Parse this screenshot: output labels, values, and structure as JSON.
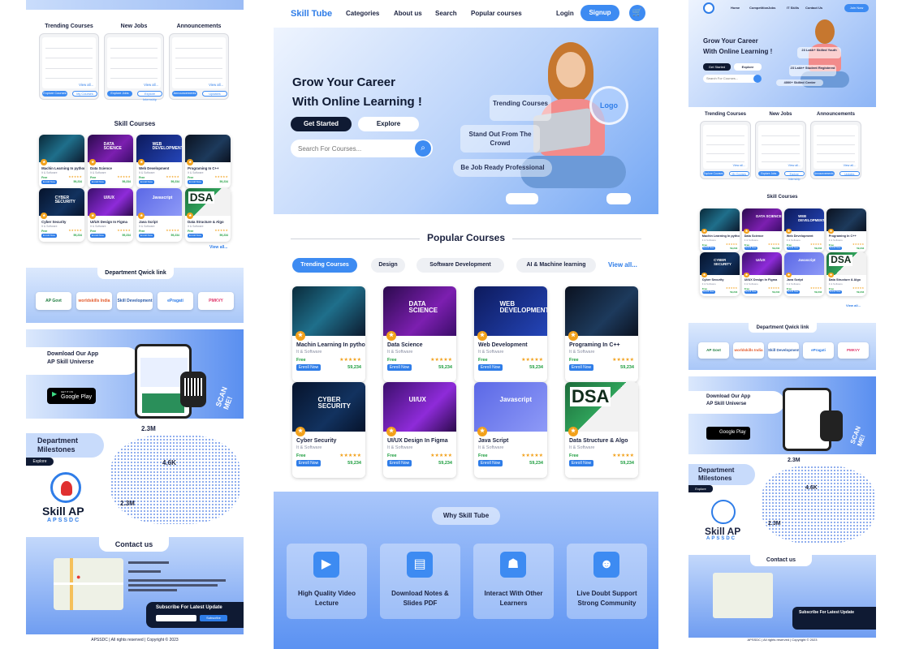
{
  "nav": {
    "brand": "Skill Tube",
    "links": [
      "Categories",
      "About us",
      "Search",
      "Popular courses"
    ],
    "login": "Login",
    "signup": "Signup"
  },
  "hero": {
    "title_line1": "Grow Your Career",
    "title_line2": "With Online Learning !",
    "get_started": "Get Started",
    "explore": "Explore",
    "search_placeholder": "Search For Courses...",
    "chip1": "Trending Courses",
    "chip2": "Stand Out From The Crowd",
    "chip3": "Be Job Ready Professional",
    "logo": "Logo"
  },
  "popular": {
    "heading": "Popular Courses",
    "tabs": [
      "Trending Courses",
      "Design",
      "Software Development",
      "AI & Machine learning"
    ],
    "view_all": "View all..."
  },
  "courses": [
    {
      "title": "Machin Learning In python",
      "category": "It & Software",
      "price": "Free",
      "enroll": "Enroll Now",
      "amount": "59,234",
      "thumb": "ai"
    },
    {
      "title": "Data Science",
      "category": "It & Software",
      "price": "Free",
      "enroll": "Enroll Now",
      "amount": "59,234",
      "thumb": "ds",
      "thumb_text": "DATA SCIENCE"
    },
    {
      "title": "Web Development",
      "category": "It & Software",
      "price": "Free",
      "enroll": "Enroll Now",
      "amount": "59,234",
      "thumb": "web",
      "thumb_text": "WEB DEVELOPMENT"
    },
    {
      "title": "Programing In C++",
      "category": "It & Software",
      "price": "Free",
      "enroll": "Enroll Now",
      "amount": "59,234",
      "thumb": "cpp"
    },
    {
      "title": "Cyber Security",
      "category": "It & Software",
      "price": "Free",
      "enroll": "Enroll Now",
      "amount": "59,234",
      "thumb": "cyber",
      "thumb_text": "CYBER SECURITY"
    },
    {
      "title": "UI/UX Design In Figma",
      "category": "It & Software",
      "price": "Free",
      "enroll": "Enroll Now",
      "amount": "59,234",
      "thumb": "uiux",
      "thumb_text": "UI/UX"
    },
    {
      "title": "Java Script",
      "category": "It & Software",
      "price": "Free",
      "enroll": "Enroll Now",
      "amount": "59,234",
      "thumb": "js",
      "thumb_text": "Javascript"
    },
    {
      "title": "Data Structure & Algo",
      "category": "It & Software",
      "price": "Free",
      "enroll": "Enroll Now",
      "amount": "59,234",
      "thumb": "dsa",
      "thumb_text": "DSA",
      "thumb_text2": "Beginner's Guide"
    }
  ],
  "why": {
    "heading": "Why Skill Tube",
    "features": [
      "High Quality Video Lecture",
      "Download Notes & Slides PDF",
      "Interact With Other Learners",
      "Live Doubt Support Strong Community"
    ]
  },
  "left": {
    "col_heads": [
      "Trending Courses",
      "New Jobs",
      "Announcements"
    ],
    "col_buttons": [
      [
        "Explore Courses",
        "My Courses"
      ],
      [
        "Explore Jobs",
        "Explore Internship"
      ],
      [
        "Announcements",
        "Updates"
      ]
    ],
    "view_all": "View all...",
    "skill_heading": "Skill Courses",
    "skill_view_all": "View all...",
    "dept_heading": "Department Qwick link",
    "dept_logos": [
      "AP Govt",
      "worldskills India",
      "Skill Development",
      "ePragati",
      "PMKVY"
    ],
    "app_title1": "Download Our App",
    "app_title2": "AP Skill Universe",
    "google_play_small": "GET IT ON",
    "google_play": "Google Play",
    "scan": "SCAN ME!",
    "milestones": "Department Milestones",
    "explore": "Explore",
    "stat1": "2.3M",
    "stat2": "4.6K",
    "stat3": "2.3M",
    "skill_ap": "Skill AP",
    "apssdc": "APSSDC",
    "contact": "Contact us",
    "subscribe": "Subscribe For Latest Update",
    "subscribe_btn": "Subscribe",
    "footer": "APSSDC | All rights reserved | Copyright © 2023"
  },
  "right": {
    "nav": [
      "Home",
      "Competition",
      "Jobs",
      "IT Skills",
      "Contact Us"
    ],
    "join": "Join Now",
    "title_line1": "Grow Your Career",
    "title_line2": "With Online Learning !",
    "get_started": "Get Started",
    "explore": "Explore",
    "search_placeholder": "Search For Courses...",
    "stat1": "23 Lakh+ Skilled Youth",
    "stat2": "23 Lakh+ Student Registered",
    "stat3": "4000+ Skilled Center"
  },
  "colors": {
    "primary": "#3d8bf2",
    "dark": "#0f1a33",
    "star": "#f2a11b",
    "green": "#1a9c3c"
  }
}
